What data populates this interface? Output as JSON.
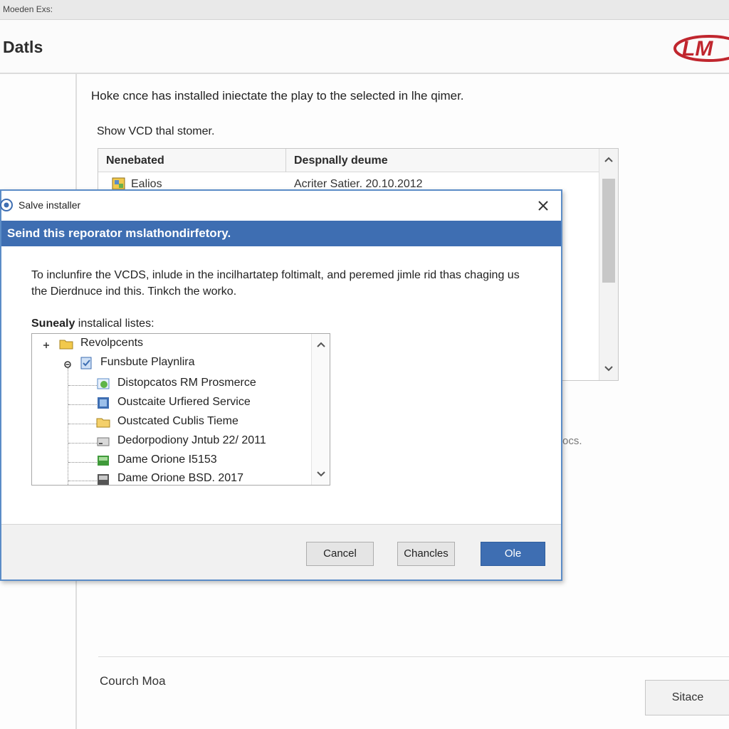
{
  "window": {
    "title": "Moeden Exs:"
  },
  "header": {
    "title": "Datls",
    "logo_text": "LM"
  },
  "main": {
    "intro": "Hoke cnce has installed iniectate the play to the selected in lhe qimer.",
    "subintro": "Show VCD thal stomer.",
    "table": {
      "columns": [
        "Nenebated",
        "Despnally deume"
      ],
      "rows": [
        {
          "name": "Ealios",
          "detail": "Acriter Satier. 20.10.2012"
        }
      ]
    },
    "faint_text": "ocs.",
    "footer_label": "Courch Moa",
    "footer_button": "Sitace"
  },
  "dialog": {
    "title": "Salve installer",
    "band": "Seind this reporator mslathondirfetory.",
    "description": "To inclunfire the VCDS, inlude in the incilhartatep foltimalt, and peremed jimle rid thas chaging us the Dierdnuce ind this. Tinkch the worko.",
    "tree_label_bold": "Sunealy",
    "tree_label_rest": " instalical listes:",
    "tree": [
      {
        "label": "Revolpcents",
        "icon": "folder-icon"
      },
      {
        "label": "Funsbute Playnlira",
        "icon": "document-icon"
      },
      {
        "label": "Distopcatos RM Prosmerce",
        "icon": "globe-icon"
      },
      {
        "label": "Oustcaite Urfiered Service",
        "icon": "blue-app-icon"
      },
      {
        "label": "Oustcated Cublis Tieme",
        "icon": "folder-icon"
      },
      {
        "label": "Dedorpodiony Jntub 22/ 2011",
        "icon": "drive-icon"
      },
      {
        "label": "Dame Orione I5153",
        "icon": "green-app-icon"
      },
      {
        "label": "Dame Orione BSD. 2017",
        "icon": "dark-app-icon"
      }
    ],
    "buttons": {
      "cancel": "Cancel",
      "changes": "Chancles",
      "ok": "Ole"
    }
  },
  "colors": {
    "accent": "#3e6eb2",
    "dialog_border": "#5b8cc7",
    "logo": "#c0262e"
  }
}
